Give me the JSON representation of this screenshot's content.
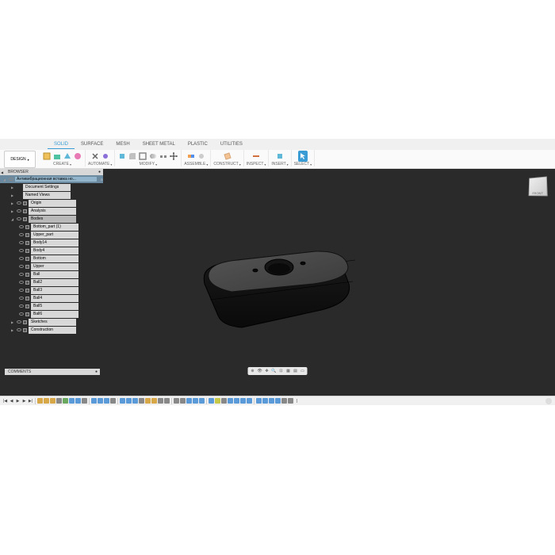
{
  "tabs": {
    "solid": "SOLID",
    "surface": "SURFACE",
    "mesh": "MESH",
    "sheetmetal": "SHEET METAL",
    "plastic": "PLASTIC",
    "utilities": "UTILITIES"
  },
  "design_button": "DESIGN",
  "toolgroups": {
    "create": "CREATE",
    "automate": "AUTOMATE",
    "modify": "MODIFY",
    "assemble": "ASSEMBLE",
    "construct": "CONSTRUCT",
    "inspect": "INSPECT",
    "insert": "INSERT",
    "select": "SELECT"
  },
  "browser": {
    "title": "BROWSER",
    "root": "Антивибрационная вставка но...",
    "items": {
      "doc": "Document Settings",
      "views": "Named Views",
      "origin": "Origin",
      "analysis": "Analysis",
      "bodies": "Bodies",
      "bottom_part": "Bottom_part (1)",
      "upper_part": "Upper_part",
      "body14": "Body14",
      "body4": "Body4",
      "bottom": "Bottom",
      "upper": "Upper",
      "ball": "Ball",
      "ball2": "Ball2",
      "ball3": "Ball3",
      "ball4": "Ball4",
      "ball5": "Ball5",
      "ball6": "Ball6",
      "sketches": "Sketches",
      "construction": "Construction"
    }
  },
  "comments": "COMMENTS",
  "viewcube": "FRONT"
}
